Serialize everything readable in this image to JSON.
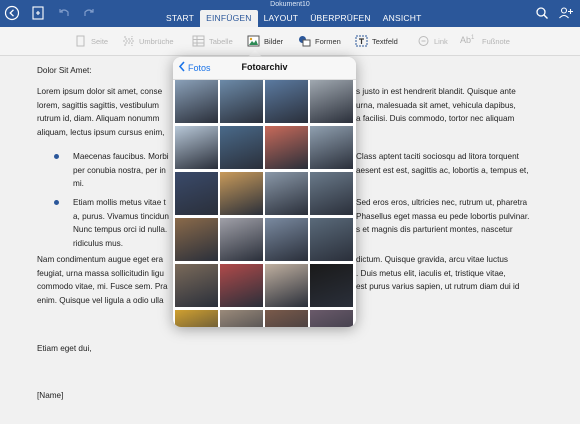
{
  "window": {
    "title": "Dokument10"
  },
  "ribbon": {
    "tabs": [
      {
        "label": "START",
        "active": false
      },
      {
        "label": "EINFÜGEN",
        "active": true
      },
      {
        "label": "LAYOUT",
        "active": false
      },
      {
        "label": "ÜBERPRÜFEN",
        "active": false
      },
      {
        "label": "ANSICHT",
        "active": false
      }
    ]
  },
  "toolbar": {
    "items": [
      {
        "label": "Seite",
        "icon": "page-icon",
        "enabled": false
      },
      {
        "label": "Umbrüche",
        "icon": "breaks-icon",
        "enabled": false
      },
      {
        "label": "Tabelle",
        "icon": "table-icon",
        "enabled": false
      },
      {
        "label": "Bilder",
        "icon": "pictures-icon",
        "enabled": true
      },
      {
        "label": "Formen",
        "icon": "shapes-icon",
        "enabled": true
      },
      {
        "label": "Textfeld",
        "icon": "textbox-icon",
        "enabled": true
      },
      {
        "label": "Link",
        "icon": "link-icon",
        "enabled": false
      },
      {
        "label": "Fußnote",
        "icon": "footnote-icon",
        "enabled": false
      }
    ]
  },
  "document": {
    "salutation": "Dolor Sit Amet:",
    "para1": [
      "Lorem ipsum dolor sit amet, conse",
      "lorem, sagittis sagittis, vestibulum",
      "rutrum id, diam. Aliquam nonumm",
      "aliquam, lectus ipsum cursus enim,"
    ],
    "para1_right": [
      "s justo in est hendrerit blandit. Quisque ante",
      "urna, malesuada sit amet, vehicula dapibus,",
      "a facilisi. Duis commodo, tortor nec aliquam",
      ""
    ],
    "bullet1": [
      "Maecenas faucibus. Morbi",
      "per conubia nostra, per in",
      "mi."
    ],
    "bullet1_right": [
      "Class aptent taciti sociosqu ad litora torquent",
      "aesent est est, sagittis ac, lobortis a, tempus et,",
      ""
    ],
    "bullet2": [
      "Etiam mollis metus vitae t",
      "a, purus. Vivamus tincidun",
      "Nunc tempus orci id nulla.",
      "ridiculus mus."
    ],
    "bullet2_right": [
      "Sed eros eros, ultricies nec, rutrum ut, pharetra",
      "Phasellus eget massa eu pede lobortis pulvinar.",
      "s et magnis dis parturient montes, nascetur",
      ""
    ],
    "para2": [
      "Nam condimentum augue eget era",
      "feugiat, urna massa sollicitudin ligu",
      "commodo vitae, mi. Fusce sem. Pra",
      "enim. Quisque vel ligula a odio ulla"
    ],
    "para2_right": [
      "dictum. Quisque gravida, arcu vitae luctus",
      ". Duis metus elit, iaculis et, tristique vitae,",
      "est purus varius sapien, ut rutrum diam dui id",
      ""
    ],
    "closing": "Etiam eget dui,",
    "signature": "[Name]"
  },
  "popover": {
    "back_label": "Fotos",
    "title": "Fotoarchiv",
    "photos": [
      "#8aa0b8",
      "#6c8aa8",
      "#5b7aa0",
      "#a0a8b0",
      "#b8c8d8",
      "#4a6a8a",
      "#c86a5a",
      "#90a0b0",
      "#3a4a6a",
      "#c89a5a",
      "#8a98a8",
      "#6a7a8a",
      "#8a6a4a",
      "#a0a0a8",
      "#7a8aa0",
      "#5a6a7a",
      "#7a6a5a",
      "#b04a4a",
      "#c0b0a0",
      "#1a1a1a",
      "#d0a030",
      "#9a8a7a",
      "#7a5a4a",
      "#6a5a6a"
    ]
  }
}
